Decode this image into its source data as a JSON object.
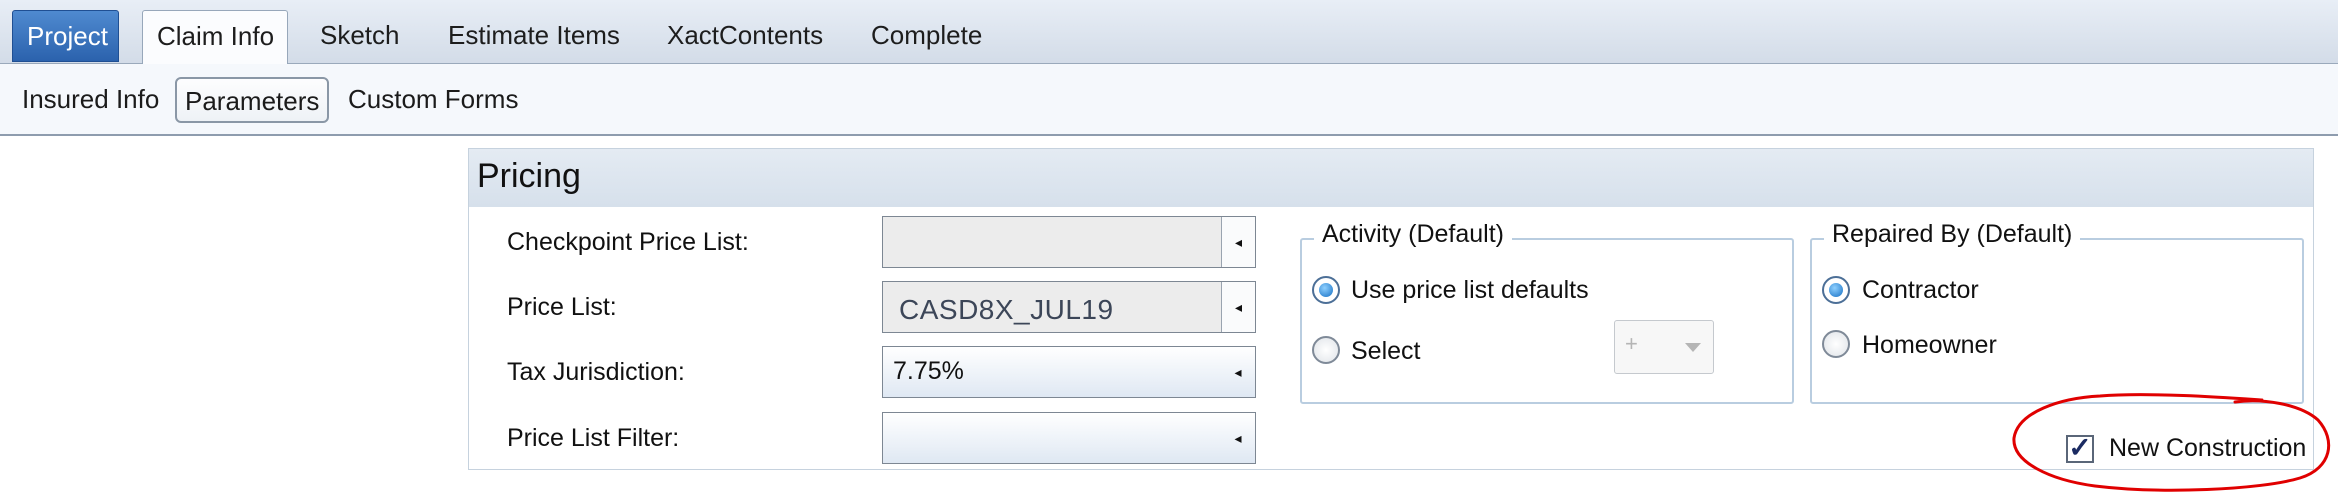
{
  "ribbon": {
    "tabs": [
      {
        "label": "Project"
      },
      {
        "label": "Claim Info"
      },
      {
        "label": "Sketch"
      },
      {
        "label": "Estimate Items"
      },
      {
        "label": "XactContents"
      },
      {
        "label": "Complete"
      }
    ],
    "active": "Claim Info"
  },
  "subtabs": {
    "items": [
      {
        "label": "Insured Info"
      },
      {
        "label": "Parameters"
      },
      {
        "label": "Custom Forms"
      }
    ],
    "active": "Parameters"
  },
  "pricing": {
    "title": "Pricing",
    "fields": [
      {
        "label": "Checkpoint Price List:",
        "value": ""
      },
      {
        "label": "Price List:",
        "value": "CASD8X_JUL19"
      },
      {
        "label": "Tax Jurisdiction:",
        "value": "7.75%"
      },
      {
        "label": "Price List Filter:",
        "value": ""
      }
    ],
    "activity": {
      "legend": "Activity (Default)",
      "options": [
        {
          "label": "Use price list defaults",
          "selected": true
        },
        {
          "label": "Select",
          "selected": false
        }
      ],
      "select_value": "+"
    },
    "repaired_by": {
      "legend": "Repaired By (Default)",
      "options": [
        {
          "label": "Contractor",
          "selected": true
        },
        {
          "label": "Homeowner",
          "selected": false
        }
      ]
    },
    "new_construction": {
      "label": "New Construction",
      "checked": true,
      "check_glyph": "✓"
    }
  },
  "icons": {
    "dropdown_arrow": "◂"
  },
  "colors": {
    "project_tab": "#2b62ad",
    "annotation_circle": "#e00000",
    "radio_selected": "#1670c4"
  }
}
